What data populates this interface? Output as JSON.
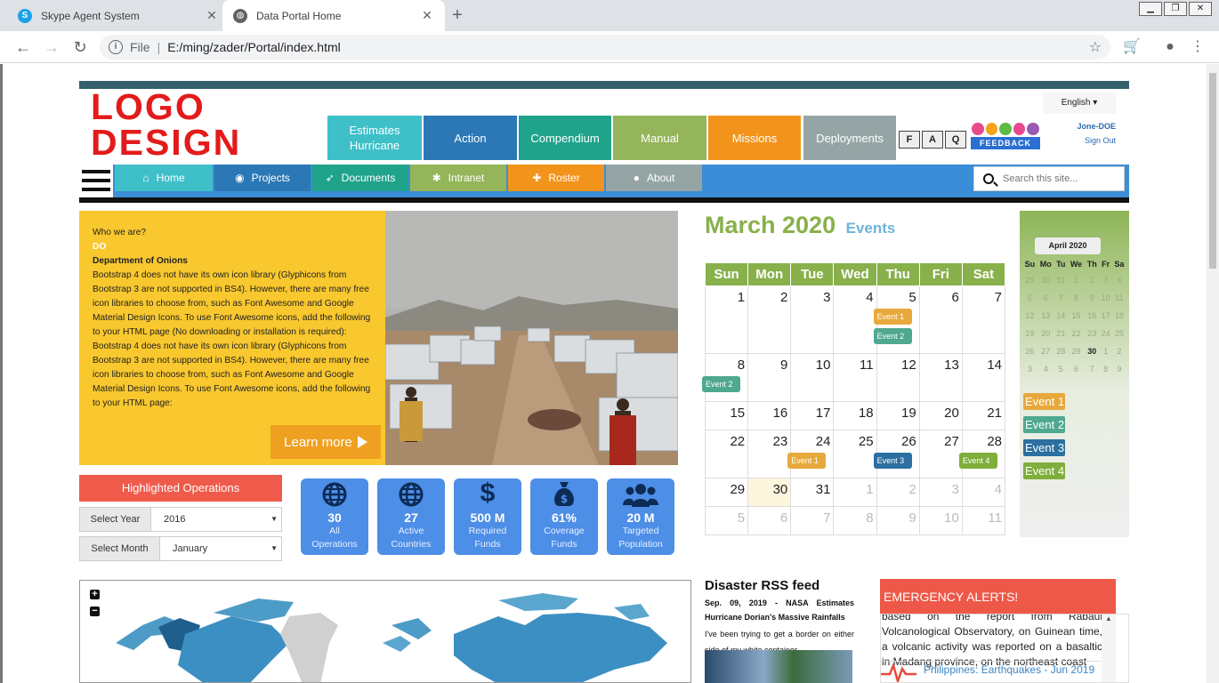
{
  "browser": {
    "tabs": [
      {
        "title": "Skype Agent System",
        "active": false
      },
      {
        "title": "Data Portal Home",
        "active": true
      }
    ],
    "address": {
      "scheme_label": "File",
      "separator": "|",
      "url": "E:/ming/zader/Portal/index.html"
    }
  },
  "logo": {
    "line1": "LOGO",
    "line2": "DESIGN"
  },
  "top_nav": [
    {
      "label": "Estimates Hurricane",
      "color": "#3fc0c9"
    },
    {
      "label": "Action",
      "color": "#2c78b6"
    },
    {
      "label": "Compendium",
      "color": "#1fa38b"
    },
    {
      "label": "Manual",
      "color": "#94b559"
    },
    {
      "label": "Missions",
      "color": "#f2941c"
    },
    {
      "label": "Deployments",
      "color": "#95a5a6"
    }
  ],
  "faq_letters": [
    "F",
    "A",
    "Q"
  ],
  "feedback_label": "FEEDBACK",
  "language": "English ▾",
  "user": {
    "name": "Jone-DOE",
    "signout": "Sign Out"
  },
  "sub_nav": [
    {
      "label": "Home",
      "icon": "⌂",
      "icon_name": "home-icon",
      "color": "#3fc0c9"
    },
    {
      "label": "Projects",
      "icon": "◉",
      "icon_name": "projects-icon",
      "color": "#2c78b6"
    },
    {
      "label": "Documents",
      "icon": "➶",
      "icon_name": "rocket-icon",
      "color": "#1fa38b"
    },
    {
      "label": "Intranet",
      "icon": "✱",
      "icon_name": "asterisk-icon",
      "color": "#94b559"
    },
    {
      "label": "Roster",
      "icon": "✚",
      "icon_name": "puzzle-icon",
      "color": "#f2941c"
    },
    {
      "label": "About",
      "icon": "●",
      "icon_name": "lightbulb-icon",
      "color": "#95a5a6"
    }
  ],
  "search": {
    "placeholder": "Search this site..."
  },
  "who": {
    "heading": "Who we are?",
    "abbr": "DO",
    "org": "Department of Onions",
    "body": "Bootstrap 4 does not have its own icon library (Glyphicons from Bootstrap 3 are not supported in BS4). However, there are many free icon libraries to choose from, such as Font Awesome and Google Material Design Icons. To use Font Awesome icons, add the following to your HTML page (No downloading or installation is required): Bootstrap 4 does not have its own icon library (Glyphicons from Bootstrap 3 are not supported in BS4). However, there are many free icon libraries to choose from, such as Font Awesome and Google Material Design Icons. To use Font Awesome icons, add the following to your HTML page:",
    "learn_more": "Learn more"
  },
  "highlighted": {
    "title": "Highlighted Operations",
    "year_label": "Select Year",
    "year_value": "2016",
    "month_label": "Select Month",
    "month_value": "January"
  },
  "stats": [
    {
      "num": "30",
      "l1": "All",
      "l2": "Operations",
      "icon": "globe-icon"
    },
    {
      "num": "27",
      "l1": "Active",
      "l2": "Countries",
      "icon": "globe-icon"
    },
    {
      "num": "500 M",
      "l1": "Required",
      "l2": "Funds",
      "icon": "dollar-icon"
    },
    {
      "num": "61%",
      "l1": "Coverage",
      "l2": "Funds",
      "icon": "money-bag-icon"
    },
    {
      "num": "20 M",
      "l1": "Targeted",
      "l2": "Population",
      "icon": "users-icon"
    }
  ],
  "calendar": {
    "month": "March 2020",
    "events_label": "Events",
    "days": [
      "Sun",
      "Mon",
      "Tue",
      "Wed",
      "Thu",
      "Fri",
      "Sat"
    ],
    "weeks": [
      [
        {
          "d": "1"
        },
        {
          "d": "2"
        },
        {
          "d": "3"
        },
        {
          "d": "4"
        },
        {
          "d": "5",
          "ev": [
            {
              "t": "Event 1",
              "c": "#e8a93c"
            },
            {
              "t": "Event 2",
              "c": "#4fa890"
            }
          ]
        },
        {
          "d": "6"
        },
        {
          "d": "7"
        }
      ],
      [
        {
          "d": "8",
          "ev": [
            {
              "t": "Event 2",
              "c": "#4fa890"
            }
          ]
        },
        {
          "d": "9"
        },
        {
          "d": "10"
        },
        {
          "d": "11"
        },
        {
          "d": "12"
        },
        {
          "d": "13"
        },
        {
          "d": "14"
        }
      ],
      [
        {
          "d": "15"
        },
        {
          "d": "16"
        },
        {
          "d": "17"
        },
        {
          "d": "18"
        },
        {
          "d": "19"
        },
        {
          "d": "20"
        },
        {
          "d": "21"
        }
      ],
      [
        {
          "d": "22"
        },
        {
          "d": "23"
        },
        {
          "d": "24",
          "ev": [
            {
              "t": "Event 1",
              "c": "#e8a93c"
            }
          ]
        },
        {
          "d": "25"
        },
        {
          "d": "26",
          "ev": [
            {
              "t": "Event 3",
              "c": "#2c6fa0"
            }
          ]
        },
        {
          "d": "27"
        },
        {
          "d": "28",
          "ev": [
            {
              "t": "Event 4",
              "c": "#7fae3b"
            }
          ]
        }
      ],
      [
        {
          "d": "29"
        },
        {
          "d": "30",
          "today": true
        },
        {
          "d": "31"
        },
        {
          "d": "1",
          "muted": true
        },
        {
          "d": "2",
          "muted": true
        },
        {
          "d": "3",
          "muted": true
        },
        {
          "d": "4",
          "muted": true
        }
      ],
      [
        {
          "d": "5",
          "muted": true
        },
        {
          "d": "6",
          "muted": true
        },
        {
          "d": "7",
          "muted": true
        },
        {
          "d": "8",
          "muted": true
        },
        {
          "d": "9",
          "muted": true
        },
        {
          "d": "10",
          "muted": true
        },
        {
          "d": "11",
          "muted": true
        }
      ]
    ]
  },
  "mini_calendar": {
    "month": "April 2020",
    "days": [
      "Su",
      "Mo",
      "Tu",
      "We",
      "Th",
      "Fr",
      "Sa"
    ],
    "weeks": [
      [
        "29",
        "30",
        "31",
        "1",
        "2",
        "3",
        "4"
      ],
      [
        "5",
        "6",
        "7",
        "8",
        "9",
        "10",
        "11"
      ],
      [
        "12",
        "13",
        "14",
        "15",
        "16",
        "17",
        "18"
      ],
      [
        "19",
        "20",
        "21",
        "22",
        "23",
        "24",
        "25"
      ],
      [
        "26",
        "27",
        "28",
        "29",
        "30",
        "1",
        "2"
      ],
      [
        "3",
        "4",
        "5",
        "6",
        "7",
        "8",
        "9"
      ]
    ],
    "highlight": "30",
    "events": [
      {
        "t": "Event 1",
        "c": "#e8a93c"
      },
      {
        "t": "Event 2",
        "c": "#4fa890"
      },
      {
        "t": "Event 3",
        "c": "#2c6fa0"
      },
      {
        "t": "Event 4",
        "c": "#7fae3b"
      }
    ]
  },
  "rss": {
    "title": "Disaster RSS feed",
    "headline": "Sep. 09, 2019 - NASA Estimates Hurricane Dorian's Massive Rainfalls",
    "text": "I've been trying to get a border on either side of my white container."
  },
  "alerts": {
    "title": "EMERGENCY ALERTS!",
    "text": "based on the report from Rabaul Volcanological Observatory, on Guinean time, a volcanic activity was reported on a basaltic in Madang province, on the northeast coast",
    "item_link": "Philippines: Earthquakes - Jun 2019"
  }
}
